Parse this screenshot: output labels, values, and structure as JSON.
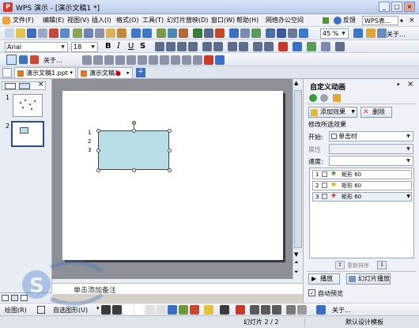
{
  "window": {
    "title": "WPS 演示 - [演示文稿1 *]",
    "app_icon_letter": "P",
    "buttons": [
      "_",
      "□",
      "×"
    ]
  },
  "menubar": {
    "items": [
      "文件(F)",
      "编辑(E)",
      "视图(V)",
      "插入(I)",
      "格式(O)",
      "工具(T)",
      "幻灯片放映(D)",
      "窗口(W)",
      "帮助(H)",
      "网络办公空间"
    ],
    "feedback": "反馈",
    "wps_search": "WPS表..."
  },
  "toolbar1": {
    "zoom": "45 %",
    "about": "关于..."
  },
  "toolbar2": {
    "font": "Arial",
    "size": "18"
  },
  "toolbar3": {
    "about": "关于..."
  },
  "tabs": {
    "doc1": "演示文稿1.ppt",
    "doc2": "演示文稿1"
  },
  "slides_panel": {
    "slide_numbers": [
      "1",
      "2"
    ]
  },
  "slide": {
    "text_lines": [
      "1",
      "2",
      "3"
    ]
  },
  "notes": {
    "placeholder": "单击添加备注"
  },
  "taskpane": {
    "title": "自定义动画",
    "add_effect": "添加效果",
    "delete": "删除",
    "modify_label": "修改所选效果",
    "start_label": "开始:",
    "start_value": "单击时",
    "property_label": "属性",
    "speed_label": "速度:",
    "animations": [
      {
        "num": "1",
        "name": "矩形 60"
      },
      {
        "num": "2",
        "name": "矩形 60"
      },
      {
        "num": "3",
        "name": "矩形 60"
      }
    ],
    "reorder": "重新排序",
    "play": "播放",
    "slideshow": "幻灯片播放",
    "autopreview": "自动预览"
  },
  "drawbar": {
    "draw": "绘图(R)",
    "autoshape": "自选图形(U)",
    "about": "关于..."
  },
  "statusbar": {
    "slide_count": "幻灯片 2 / 2",
    "template": "默认设计模板"
  }
}
